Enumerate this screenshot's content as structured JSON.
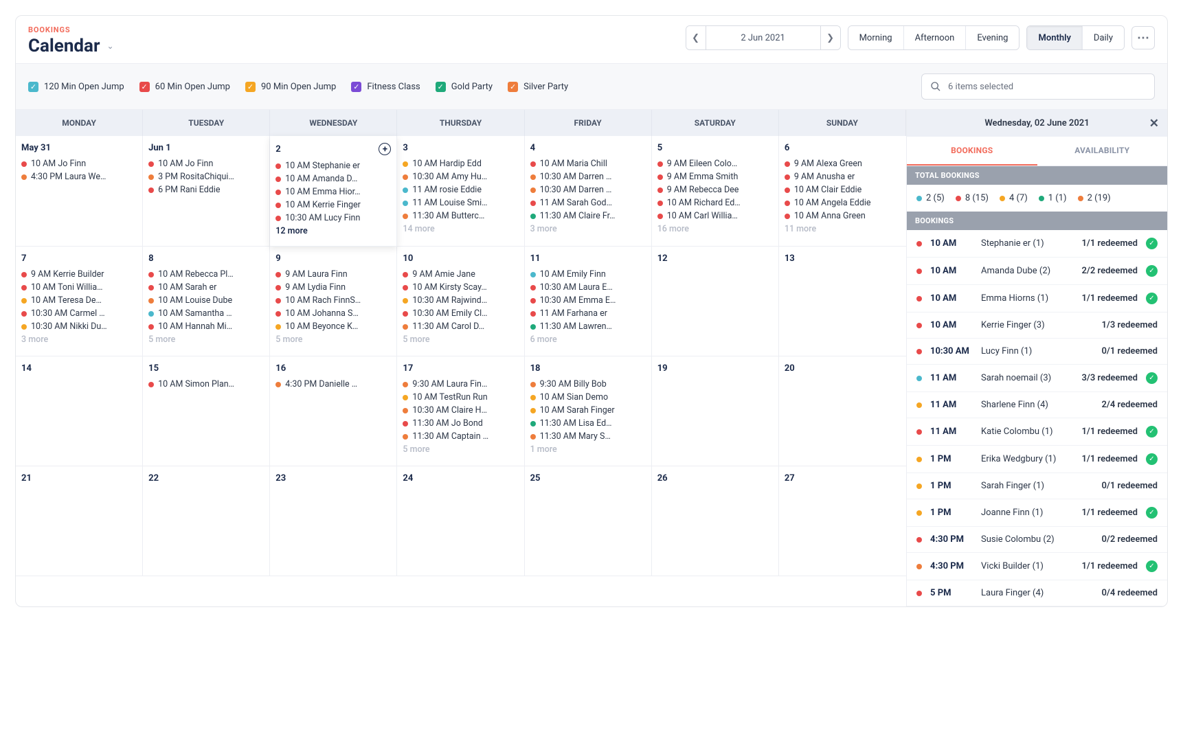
{
  "header": {
    "eyebrow": "BOOKINGS",
    "title": "Calendar",
    "date": "2 Jun 2021",
    "timeOfDay": [
      "Morning",
      "Afternoon",
      "Evening"
    ],
    "view": [
      "Monthly",
      "Daily"
    ],
    "viewActive": "Monthly"
  },
  "filters": {
    "items": [
      {
        "label": "120 Min Open Jump",
        "color": "c-cyan"
      },
      {
        "label": "60 Min Open Jump",
        "color": "c-red"
      },
      {
        "label": "90 Min Open Jump",
        "color": "c-amber"
      },
      {
        "label": "Fitness Class",
        "color": "c-purple"
      },
      {
        "label": "Gold Party",
        "color": "c-green"
      },
      {
        "label": "Silver Party",
        "color": "c-orange"
      }
    ],
    "selectLabel": "6 items selected"
  },
  "dayHeaders": [
    "MONDAY",
    "TUESDAY",
    "WEDNESDAY",
    "THURSDAY",
    "FRIDAY",
    "SATURDAY",
    "SUNDAY"
  ],
  "cells": [
    {
      "label": "May 31",
      "events": [
        {
          "c": "c-red",
          "t": "10 AM Jo Finn"
        },
        {
          "c": "c-orange",
          "t": "4:30 PM Laura We…"
        }
      ]
    },
    {
      "label": "Jun 1",
      "events": [
        {
          "c": "c-red",
          "t": "10 AM Jo Finn"
        },
        {
          "c": "c-orange",
          "t": "3 PM RositaChiqui…"
        },
        {
          "c": "c-red",
          "t": "6 PM Rani Eddie"
        }
      ]
    },
    {
      "label": "2",
      "selected": true,
      "showAdd": true,
      "events": [
        {
          "c": "c-red",
          "t": "10 AM Stephanie er"
        },
        {
          "c": "c-red",
          "t": "10 AM Amanda D…"
        },
        {
          "c": "c-red",
          "t": "10 AM Emma Hior…"
        },
        {
          "c": "c-red",
          "t": "10 AM Kerrie Finger"
        },
        {
          "c": "c-red",
          "t": "10:30 AM Lucy Finn"
        }
      ],
      "more": "12 more",
      "moreStrong": true
    },
    {
      "label": "3",
      "events": [
        {
          "c": "c-amber",
          "t": "10 AM Hardip Edd"
        },
        {
          "c": "c-orange",
          "t": "10:30 AM Amy Hu…"
        },
        {
          "c": "c-cyan",
          "t": "11 AM rosie Eddie"
        },
        {
          "c": "c-cyan",
          "t": "11 AM Louise Smi…"
        },
        {
          "c": "c-orange",
          "t": "11:30 AM Butterc…"
        }
      ],
      "more": "14 more"
    },
    {
      "label": "4",
      "events": [
        {
          "c": "c-red",
          "t": "10 AM Maria Chill"
        },
        {
          "c": "c-orange",
          "t": "10:30 AM Darren …"
        },
        {
          "c": "c-orange",
          "t": "10:30 AM Darren …"
        },
        {
          "c": "c-red",
          "t": "11 AM Sarah God…"
        },
        {
          "c": "c-green",
          "t": "11:30 AM Claire Fr…"
        }
      ],
      "more": "3 more"
    },
    {
      "label": "5",
      "events": [
        {
          "c": "c-red",
          "t": "9 AM Eileen Colo…"
        },
        {
          "c": "c-red",
          "t": "9 AM Emma Smith"
        },
        {
          "c": "c-red",
          "t": "9 AM Rebecca Dee"
        },
        {
          "c": "c-red",
          "t": "10 AM Richard Ed…"
        },
        {
          "c": "c-red",
          "t": "10 AM Carl Willia…"
        }
      ],
      "more": "16 more"
    },
    {
      "label": "6",
      "events": [
        {
          "c": "c-red",
          "t": "9 AM Alexa Green"
        },
        {
          "c": "c-red",
          "t": "9 AM Anusha er"
        },
        {
          "c": "c-red",
          "t": "10 AM Clair Eddie"
        },
        {
          "c": "c-red",
          "t": "10 AM Angela Eddie"
        },
        {
          "c": "c-red",
          "t": "10 AM Anna Green"
        }
      ],
      "more": "11 more"
    },
    {
      "label": "7",
      "events": [
        {
          "c": "c-red",
          "t": "9 AM Kerrie Builder"
        },
        {
          "c": "c-red",
          "t": "10 AM Toni Willia…"
        },
        {
          "c": "c-amber",
          "t": "10 AM Teresa De…"
        },
        {
          "c": "c-red",
          "t": "10:30 AM Carmel …"
        },
        {
          "c": "c-amber",
          "t": "10:30 AM Nikki Du…"
        }
      ],
      "more": "3 more"
    },
    {
      "label": "8",
      "events": [
        {
          "c": "c-red",
          "t": "10 AM Rebecca Pl…"
        },
        {
          "c": "c-red",
          "t": "10 AM Sarah er"
        },
        {
          "c": "c-orange",
          "t": "10 AM Louise Dube"
        },
        {
          "c": "c-cyan",
          "t": "10 AM Samantha …"
        },
        {
          "c": "c-red",
          "t": "10 AM Hannah Mi…"
        }
      ],
      "more": "5 more"
    },
    {
      "label": "9",
      "events": [
        {
          "c": "c-red",
          "t": "9 AM Laura Finn"
        },
        {
          "c": "c-red",
          "t": "9 AM Lydia Finn"
        },
        {
          "c": "c-red",
          "t": "10 AM Rach FinnS…"
        },
        {
          "c": "c-red",
          "t": "10 AM Johanna S…"
        },
        {
          "c": "c-amber",
          "t": "10 AM Beyonce K…"
        }
      ],
      "more": "5 more"
    },
    {
      "label": "10",
      "events": [
        {
          "c": "c-red",
          "t": "9 AM Amie Jane"
        },
        {
          "c": "c-red",
          "t": "10 AM Kirsty Scay…"
        },
        {
          "c": "c-amber",
          "t": "10:30 AM Rajwind…"
        },
        {
          "c": "c-red",
          "t": "10:30 AM Emily Cl…"
        },
        {
          "c": "c-orange",
          "t": "11:30 AM Carol D…"
        }
      ],
      "more": "5 more"
    },
    {
      "label": "11",
      "events": [
        {
          "c": "c-cyan",
          "t": "10 AM Emily Finn"
        },
        {
          "c": "c-red",
          "t": "10:30 AM Laura E…"
        },
        {
          "c": "c-red",
          "t": "10:30 AM Emma E…"
        },
        {
          "c": "c-red",
          "t": "11 AM Farhana er"
        },
        {
          "c": "c-green",
          "t": "11:30 AM Lawren…"
        }
      ],
      "more": "6 more"
    },
    {
      "label": "12"
    },
    {
      "label": "13"
    },
    {
      "label": "14"
    },
    {
      "label": "15",
      "events": [
        {
          "c": "c-red",
          "t": "10 AM Simon Plan…"
        }
      ]
    },
    {
      "label": "16",
      "events": [
        {
          "c": "c-orange",
          "t": "4:30 PM Danielle …"
        }
      ]
    },
    {
      "label": "17",
      "events": [
        {
          "c": "c-orange",
          "t": "9:30 AM Laura Fin…"
        },
        {
          "c": "c-amber",
          "t": "10 AM TestRun Run"
        },
        {
          "c": "c-orange",
          "t": "10:30 AM Claire H…"
        },
        {
          "c": "c-red",
          "t": "11:30 AM Jo Bond"
        },
        {
          "c": "c-orange",
          "t": "11:30 AM Captain …"
        }
      ],
      "more": "5 more"
    },
    {
      "label": "18",
      "events": [
        {
          "c": "c-orange",
          "t": "9:30 AM Billy Bob"
        },
        {
          "c": "c-amber",
          "t": "10 AM Sian Demo"
        },
        {
          "c": "c-amber",
          "t": "10 AM Sarah Finger"
        },
        {
          "c": "c-green",
          "t": "11:30 AM Lisa Ed…"
        },
        {
          "c": "c-orange",
          "t": "11:30 AM Mary S…"
        }
      ],
      "more": "1 more"
    },
    {
      "label": "19"
    },
    {
      "label": "20"
    },
    {
      "label": "21"
    },
    {
      "label": "22"
    },
    {
      "label": "23"
    },
    {
      "label": "24"
    },
    {
      "label": "25"
    },
    {
      "label": "26"
    },
    {
      "label": "27"
    }
  ],
  "panel": {
    "title": "Wednesday, 02 June 2021",
    "tabs": [
      "BOOKINGS",
      "AVAILABILITY"
    ],
    "activeTab": "BOOKINGS",
    "totalsLabel": "TOTAL BOOKINGS",
    "totals": [
      {
        "c": "c-cyan",
        "t": "2 (5)"
      },
      {
        "c": "c-red",
        "t": "8 (15)"
      },
      {
        "c": "c-amber",
        "t": "4 (7)"
      },
      {
        "c": "c-green",
        "t": "1 (1)"
      },
      {
        "c": "c-orange",
        "t": "2 (19)"
      }
    ],
    "bookingsLabel": "BOOKINGS",
    "rows": [
      {
        "c": "c-red",
        "time": "10 AM",
        "name": "Stephanie er (1)",
        "red": "1/1 redeemed",
        "ok": true
      },
      {
        "c": "c-red",
        "time": "10 AM",
        "name": "Amanda Dube (2)",
        "red": "2/2 redeemed",
        "ok": true
      },
      {
        "c": "c-red",
        "time": "10 AM",
        "name": "Emma Hiorns (1)",
        "red": "1/1 redeemed",
        "ok": true
      },
      {
        "c": "c-red",
        "time": "10 AM",
        "name": "Kerrie Finger (3)",
        "red": "1/3 redeemed",
        "ok": false
      },
      {
        "c": "c-red",
        "time": "10:30 AM",
        "name": "Lucy Finn (1)",
        "red": "0/1 redeemed",
        "ok": false
      },
      {
        "c": "c-cyan",
        "time": "11 AM",
        "name": "Sarah noemail (3)",
        "red": "3/3 redeemed",
        "ok": true
      },
      {
        "c": "c-amber",
        "time": "11 AM",
        "name": "Sharlene Finn (4)",
        "red": "2/4 redeemed",
        "ok": false
      },
      {
        "c": "c-red",
        "time": "11 AM",
        "name": "Katie Colombu (1)",
        "red": "1/1 redeemed",
        "ok": true
      },
      {
        "c": "c-amber",
        "time": "1 PM",
        "name": "Erika Wedgbury (1)",
        "red": "1/1 redeemed",
        "ok": true
      },
      {
        "c": "c-amber",
        "time": "1 PM",
        "name": "Sarah Finger (1)",
        "red": "0/1 redeemed",
        "ok": false
      },
      {
        "c": "c-amber",
        "time": "1 PM",
        "name": "Joanne Finn (1)",
        "red": "1/1 redeemed",
        "ok": true
      },
      {
        "c": "c-red",
        "time": "4:30 PM",
        "name": "Susie Colombu (2)",
        "red": "0/2 redeemed",
        "ok": false
      },
      {
        "c": "c-orange",
        "time": "4:30 PM",
        "name": "Vicki Builder (1)",
        "red": "1/1 redeemed",
        "ok": true
      },
      {
        "c": "c-red",
        "time": "5 PM",
        "name": "Laura Finger (4)",
        "red": "0/4 redeemed",
        "ok": false
      }
    ]
  }
}
